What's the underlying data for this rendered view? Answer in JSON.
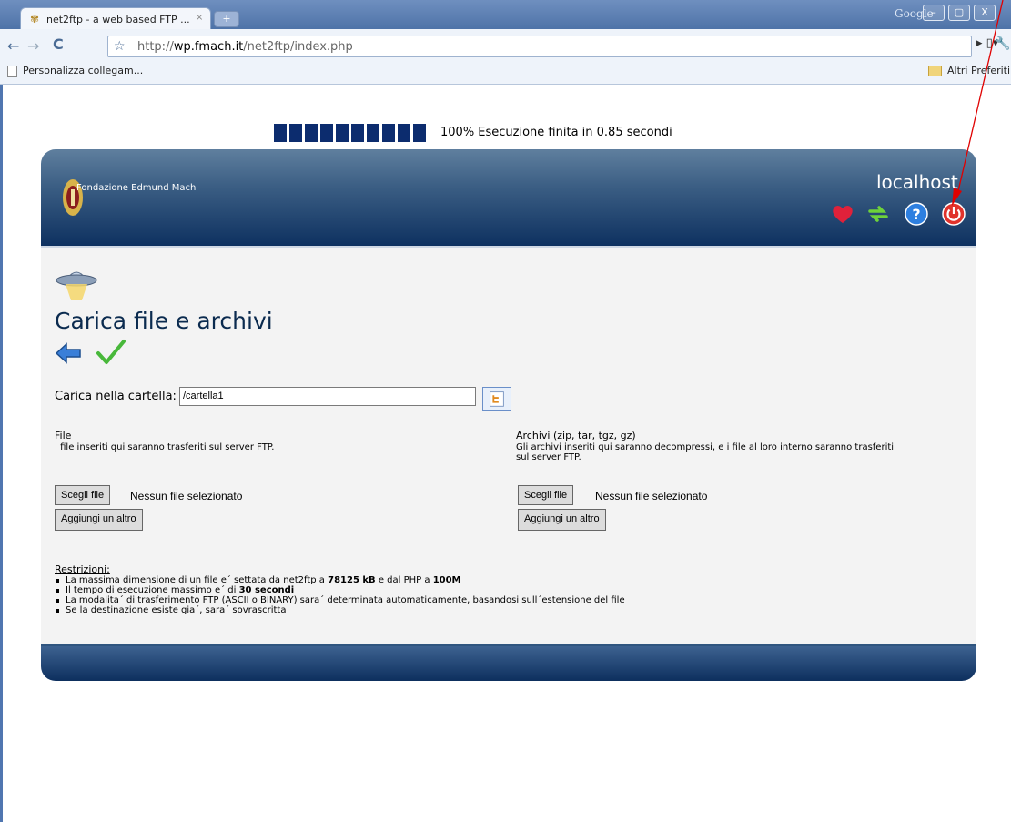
{
  "browser": {
    "tab_title": "net2ftp - a web based FTP ...",
    "tab_close": "×",
    "new_tab": "+",
    "search_brand": "Google",
    "url_host": "wp.fmach.it",
    "url_prefix": "http://",
    "url_path": "/net2ftp/index.php",
    "bookmarks": {
      "left": "Personalizza collegam...",
      "right": "Altri Preferiti"
    }
  },
  "progress": {
    "blocks": 10,
    "text": "100% Esecuzione finita in 0.85 secondi"
  },
  "header": {
    "brand": "Fondazione Edmund Mach",
    "host": "localhost",
    "icons": [
      "heart-icon",
      "refresh-icon",
      "help-icon",
      "logout-icon"
    ]
  },
  "page": {
    "title": "Carica file e archivi",
    "dir_label": "Carica nella cartella:",
    "dir_value": "/cartella1",
    "files": {
      "heading": "File",
      "description": "I file inseriti qui saranno trasferiti sul server FTP.",
      "choose_label": "Scegli file",
      "status": "Nessun file selezionato",
      "add_label": "Aggiungi un altro"
    },
    "archives": {
      "heading": "Archivi (zip, tar, tgz, gz)",
      "description_1": "Gli archivi inseriti qui saranno decompressi, e i file al loro interno saranno trasferiti",
      "description_2": "sul server FTP.",
      "choose_label": "Scegli file",
      "status": "Nessun file selezionato",
      "add_label": "Aggiungi un altro"
    },
    "restrictions": {
      "heading": "Restrizioni:",
      "r1_a": "La massima dimensione di un file e´ settata da net2ftp a ",
      "r1_b": "78125 kB",
      "r1_c": " e dal PHP a ",
      "r1_d": "100M",
      "r2_a": "Il tempo di esecuzione massimo e´ di ",
      "r2_b": "30 secondi",
      "r3": "La modalita´ di trasferimento FTP (ASCII o BINARY) sara´ determinata automaticamente, basandosi sull´estensione del file",
      "r4": "Se la destinazione esiste gia´, sara´ sovrascritta"
    }
  },
  "colors": {
    "header_dark": "#0e3160",
    "title": "#0b2b4f",
    "annotation": "#e00000"
  }
}
